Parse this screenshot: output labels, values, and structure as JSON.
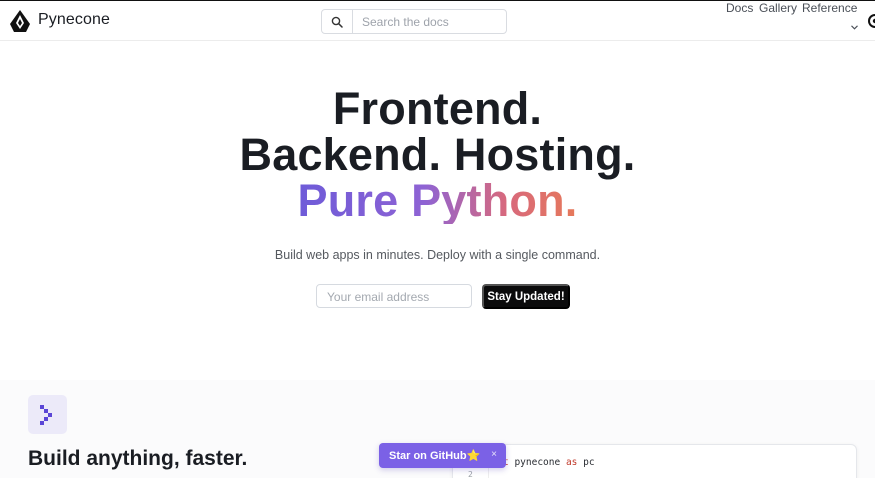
{
  "nav": {
    "brand": "Pynecone",
    "search_placeholder": "Search the docs",
    "links": {
      "docs": "Docs",
      "gallery": "Gallery",
      "reference": "Reference"
    }
  },
  "hero": {
    "line1": "Frontend.",
    "line2": "Backend. Hosting.",
    "line3": "Pure Python.",
    "tagline": "Build web apps in minutes. Deploy with a single command."
  },
  "signup": {
    "email_placeholder": "Your email address",
    "button": "Stay Updated!"
  },
  "feature": {
    "title": "Build anything, faster."
  },
  "code": {
    "line1_pre": "t ",
    "line1_mod": "pynecone",
    "line1_as": "as",
    "line1_alias": "pc",
    "line2_number": "2"
  },
  "toast": {
    "label": "Star on GitHub",
    "star": "⭐",
    "close": "×"
  },
  "colors": {
    "accent": "#7b61e6",
    "gradient_start": "#6e5bd8",
    "gradient_end": "#e6795a",
    "button_dark": "#0b0b0c"
  },
  "icons": [
    "pynecone-logo-icon",
    "search-icon",
    "chevron-down-icon",
    "github-icon",
    "terminal-prompt-icon",
    "star-icon",
    "close-icon"
  ]
}
